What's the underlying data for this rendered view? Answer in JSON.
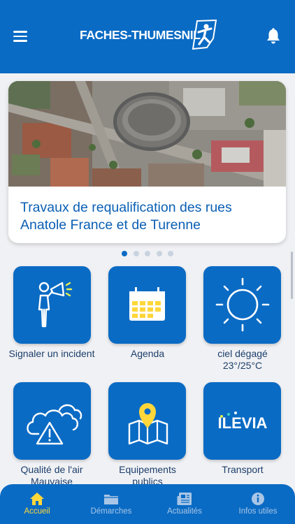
{
  "header": {
    "logo_text": "FACHES-THUMESNIL",
    "icons": {
      "menu": "hamburger-menu-icon",
      "notifications": "bell-icon",
      "logo": "running-figure-logo"
    }
  },
  "news_carousel": {
    "title": "Travaux de requalification des rues Anatole France et de Turenne",
    "page_count": 5,
    "active_page": 1
  },
  "tiles": [
    {
      "label": "Signaler un incident",
      "icon": "megaphone-person-icon"
    },
    {
      "label": "Agenda",
      "icon": "calendar-icon"
    },
    {
      "label": "ciel dégagé",
      "sublabel": "23°/25°C",
      "icon": "sun-icon"
    },
    {
      "label": "Qualité de l'air",
      "sublabel": "Mauvaise",
      "icon": "cloud-warning-icon"
    },
    {
      "label": "Equipements",
      "sublabel": "publics",
      "icon": "map-pin-icon"
    },
    {
      "label": "Transport",
      "logo_text": "ILEVIA",
      "icon": "ilevia-logo"
    }
  ],
  "tabbar": {
    "tabs": [
      {
        "label": "Accueil",
        "icon": "home-icon",
        "active": true
      },
      {
        "label": "Démarches",
        "icon": "folder-icon",
        "active": false
      },
      {
        "label": "Actualités",
        "icon": "newspaper-icon",
        "active": false
      },
      {
        "label": "Infos utiles",
        "icon": "info-icon",
        "active": false
      }
    ]
  },
  "colors": {
    "primary": "#0a6bc4",
    "accent_yellow": "#ffd73a",
    "tile_label": "#1c3e6b",
    "card_title": "#0a5fb4"
  }
}
